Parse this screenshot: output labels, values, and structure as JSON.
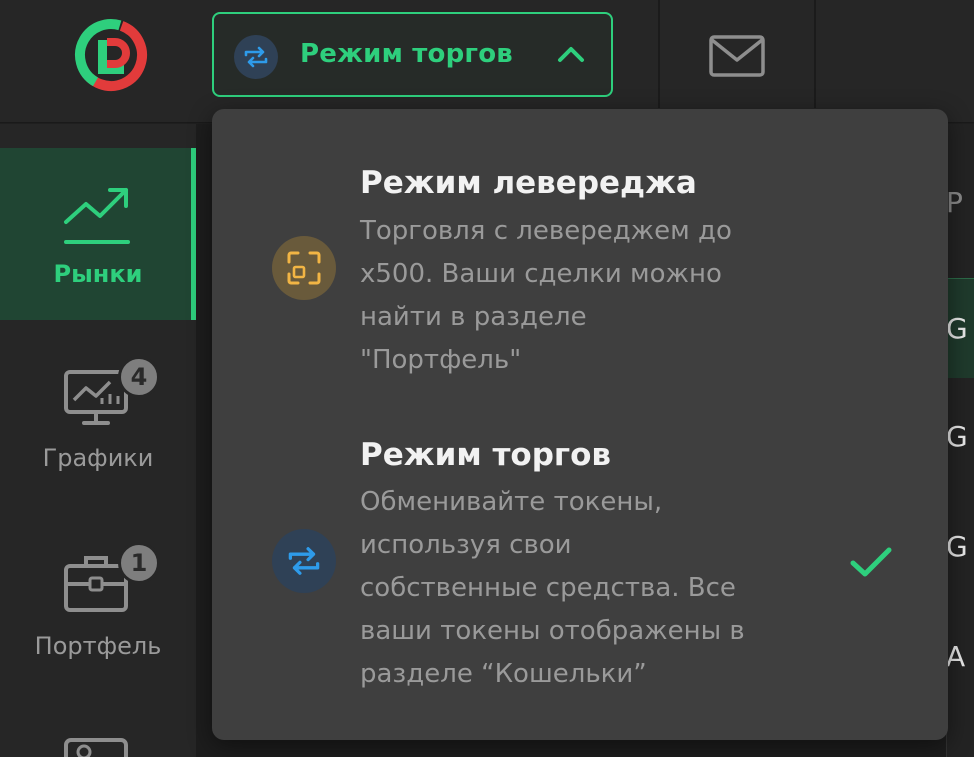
{
  "header": {
    "mode_button_label": "Режим торгов",
    "mode_button_icon": "swap-arrows-icon",
    "mode_button_state": "expanded",
    "mail_icon": "mail-icon",
    "accent_color": "#2ecf7d"
  },
  "sidebar": {
    "items": [
      {
        "label": "Рынки",
        "icon": "trending-up-icon",
        "active": true,
        "badge": ""
      },
      {
        "label": "Графики",
        "icon": "chart-monitor-icon",
        "active": false,
        "badge": "4"
      },
      {
        "label": "Портфель",
        "icon": "briefcase-icon",
        "active": false,
        "badge": "1"
      }
    ]
  },
  "dropdown": {
    "options": [
      {
        "title": "Режим левереджа",
        "description": [
          "Торговля с левереджем до",
          "x500. Ваши сделки можно",
          "найти в разделе",
          "\"Портфель\""
        ],
        "icon": "leverage-frame-icon",
        "icon_color": "#f2b544",
        "selected": false
      },
      {
        "title": "Режим торгов",
        "description": [
          "Обменивайте токены,",
          "используя свои",
          "собственные средства. Все",
          "ваши токены отображены в",
          "разделе “Кошельки”"
        ],
        "icon": "swap-arrows-icon",
        "icon_color": "#2e9bea",
        "selected": true
      }
    ]
  },
  "background_list": {
    "header_fragment": "Р",
    "row_fragments": [
      "G",
      "G",
      "G",
      "A"
    ]
  }
}
